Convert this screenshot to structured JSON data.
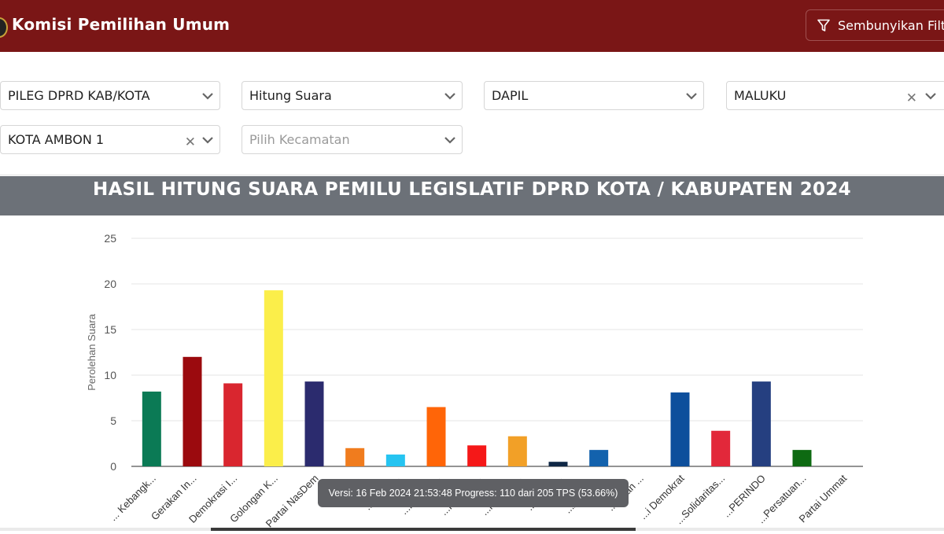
{
  "header": {
    "title": "Komisi Pemilihan Umum",
    "hide_filter_label": "Sembunyikan Filter"
  },
  "filters": {
    "election": "PILEG DPRD KAB/KOTA",
    "count_type": "Hitung Suara",
    "region_type": "DAPIL",
    "province": "MALUKU",
    "dapil": "KOTA AMBON 1",
    "kecamatan_placeholder": "Pilih Kecamatan"
  },
  "chart_title": "HASIL HITUNG SUARA PEMILU LEGISLATIF DPRD KOTA / KABUPATEN 2024",
  "tooltip": "Versi: 16 Feb 2024 21:53:48 Progress: 110 dari 205 TPS (53.66%)",
  "chart_data": {
    "type": "bar",
    "ylabel": "Perolehan Suara",
    "xlabel": "",
    "ylim": [
      0,
      25
    ],
    "yticks": [
      "0",
      "5",
      "10",
      "15",
      "20",
      "25"
    ],
    "grid": true,
    "categories": [
      "... Kebangk...",
      "Gerakan In...",
      "Demokrasi I...",
      "Golongan K...",
      "Partai NasDem",
      "Partai ...",
      "...elomb...",
      "...Keadila...",
      "...Kebang...",
      "...mati Nu...",
      "...Garda...",
      "...Amana...",
      "...Bulan ...",
      "...i Demokrat",
      "...Solidaritas...",
      "...PERINDO",
      "...Persatuan...",
      "Partai Ummat"
    ],
    "values": [
      8.2,
      12,
      9.1,
      19.3,
      9.3,
      2,
      1.3,
      6.5,
      2.3,
      3.3,
      0.5,
      1.8,
      0,
      8.1,
      3.9,
      9.3,
      1.8,
      0
    ],
    "colors": [
      "#0b7a55",
      "#9b0a0e",
      "#d9262f",
      "#fbee4a",
      "#2b2b6e",
      "#f07c1e",
      "#26c4f1",
      "#ff6508",
      "#f51818",
      "#f2a027",
      "#0f2745",
      "#1362ad",
      "#1e6b3a",
      "#0d4f9c",
      "#e2283a",
      "#253f80",
      "#0e6a12",
      "#1d7b2f"
    ]
  }
}
